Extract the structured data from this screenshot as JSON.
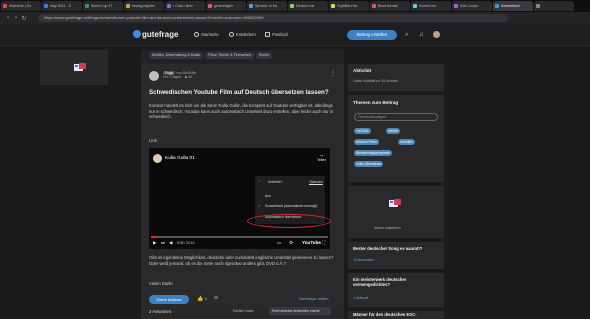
{
  "browser": {
    "tabs": [
      {
        "label": "Startseite | Gu",
        "color": "#e04a3a"
      },
      {
        "label": "May 2021 - Ti",
        "color": "#3b7ad8"
      },
      {
        "label": "World Cup 47",
        "color": "#2f9a5c"
      },
      {
        "label": "bewegungsfrei",
        "color": "#d7a23a"
      },
      {
        "label": "• Chat • Bele",
        "color": "#8a6ad8"
      },
      {
        "label": "gesendagen",
        "color": "#d85a8a"
      },
      {
        "label": "Sprache in fra",
        "color": "#5aa0d8"
      },
      {
        "label": "Deutsch ein",
        "color": "#8ad85a"
      },
      {
        "label": "TopMitte-Hisr",
        "color": "#d8d85a"
      },
      {
        "label": "Bewerberate",
        "color": "#d85a5a"
      },
      {
        "label": "Kommt mit",
        "color": "#5ad8c8"
      },
      {
        "label": "Köln Conpu",
        "color": "#a85ad8"
      },
      {
        "label": "Schwedisch",
        "color": "#3b9ad8"
      },
      {
        "label": "",
        "color": "#888888"
      }
    ],
    "active_tab_index": 12,
    "url": "https://www.gutefrage.net/frage/schwedischen-youtube-film-auf-deutsch-uebersetzen-lassen?foundIn=unknown=408963990"
  },
  "header": {
    "logo": "gutefrage",
    "nav": [
      "Startseite",
      "Entdecken",
      "Postfach"
    ],
    "ask_button": "Beitrag erstellen"
  },
  "main": {
    "breadcrumbs": [
      "Medien, Unterhaltung & Musik",
      "Filme, Serien & Fernsehen",
      "Serien"
    ],
    "question": {
      "badge": "Frage",
      "author": "von Bulli19hr",
      "time": "vor 2 Tagen",
      "views": "45",
      "title": "Schwedischen Youtube Film auf Deutsch übersetzen lassen?",
      "body1": "Kontext handelt es sich um die Serie 'Kulla Gulla', die komplett auf Youtube verfügbar ist, allerdings nur in schwedisch. Youtube kann auch automatisch Untertitel dazu erstellen, aber leider auch nur in schwedisch.",
      "link_label": "Link:",
      "body2": "Gibt es irgendeine Möglichkeit, deutsche oder zumindest englische Untertitel generieren zu lassen? Oder weiß jemand, ob es die Serie noch irgendwo anders gibt, DVD o.Ä.?",
      "thanks": "Vielen Dank!"
    },
    "video": {
      "title": "Kulla Gulla 01",
      "share": "Teilen",
      "menu_header": "Untertitel",
      "menu_options": "Optionen",
      "menu_items": [
        "Aus",
        "Schwedisch (automatisch erzeugt)",
        "Automatisch übersetzen"
      ],
      "time": "0:05 / 22:10",
      "progress": 0.04,
      "youtube": "YouTube"
    },
    "actions": {
      "answer_button": "Deine Antwort",
      "likes": "4",
      "report": "Nachfrage stellen"
    },
    "answers": {
      "count": "3 Antworten",
      "sort_label": "Sortiert nach:",
      "sort_value": "Relevanteste Antworten zuerst"
    }
  },
  "sidebar": {
    "activity_title": "Aktivität",
    "activity_text": "Letzte Aktivität vor 51 Minuten",
    "topics_title": "Themen zum Beitrag",
    "tag_placeholder": "Thema hinzufügen",
    "tags": [
      "YouTube",
      "Medien",
      "Amazon Prime",
      "Untertitel",
      "Übersetzungsprogramm",
      "Video-Übersetzen"
    ],
    "ad_label": "Nutzer empfehlen",
    "related": [
      {
        "title": "Bester deutscher Song ev aaarot!?",
        "answers": "13 Antworten"
      },
      {
        "title": "Ein meisterwerk deutscher vermengedichtes?",
        "answers": "1 Antwort"
      },
      {
        "title": "Männer für den deutschen ESC-",
        "answers": ""
      }
    ]
  }
}
